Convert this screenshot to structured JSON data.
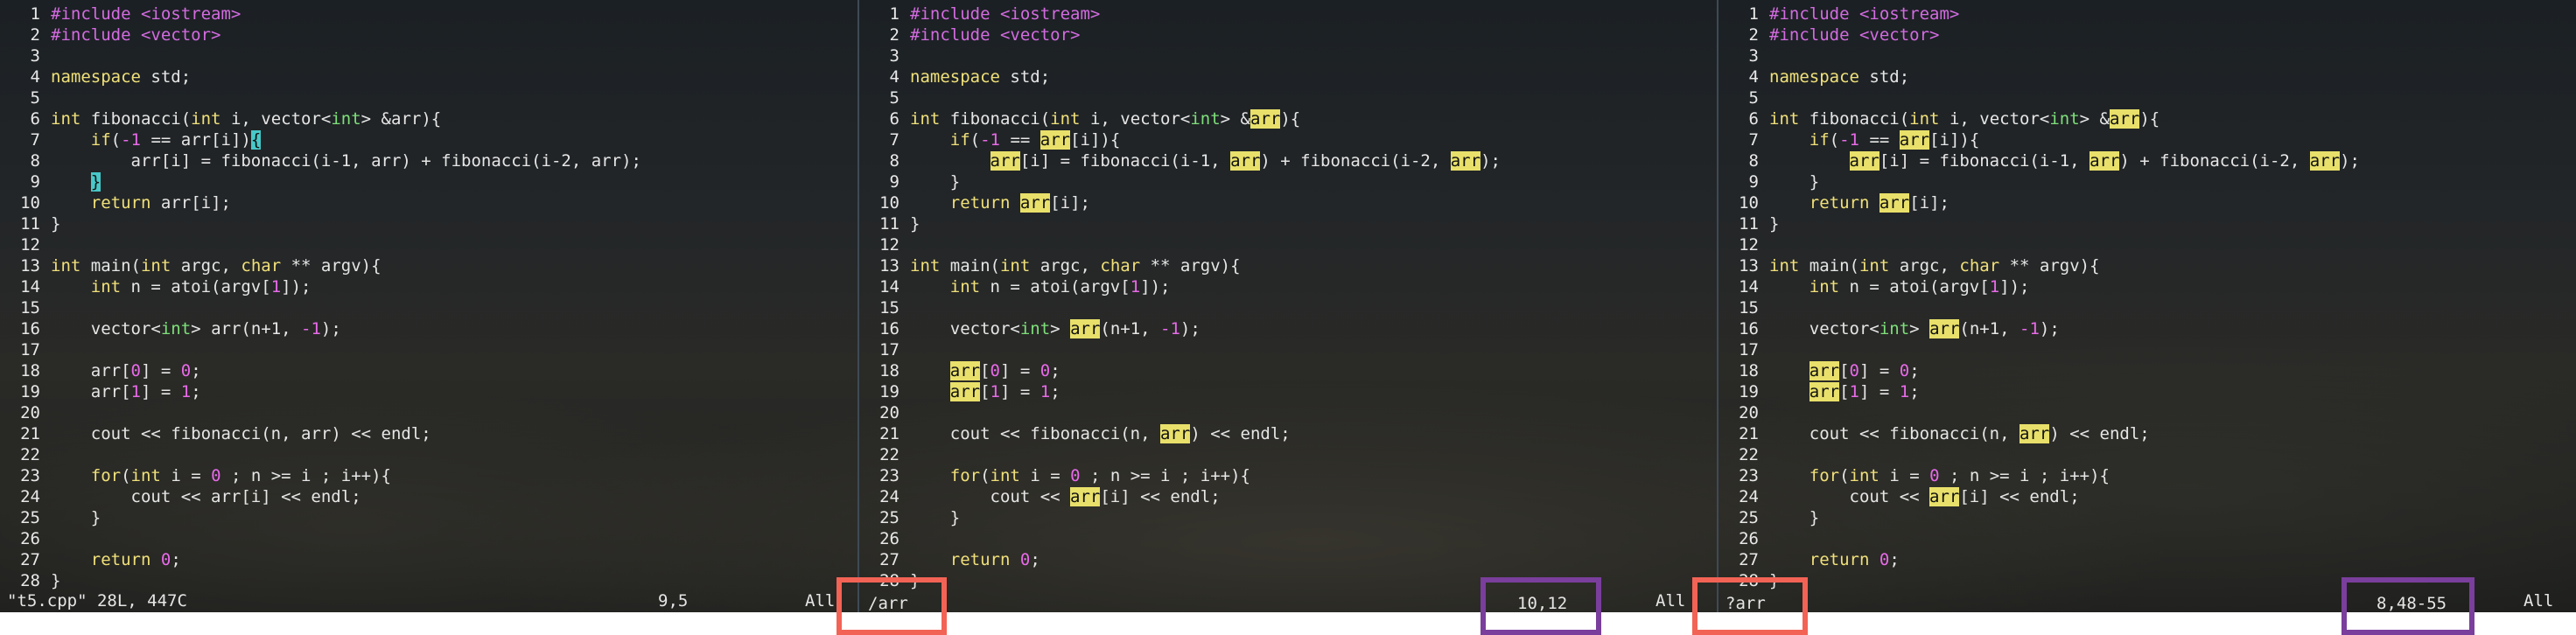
{
  "panes": [
    {
      "line_numbers": [
        "1",
        "2",
        "3",
        "4",
        "5",
        "6",
        "7",
        "8",
        "9",
        "10",
        "11",
        "12",
        "13",
        "14",
        "15",
        "16",
        "17",
        "18",
        "19",
        "20",
        "21",
        "22",
        "23",
        "24",
        "25",
        "26",
        "27",
        "28"
      ],
      "status_left": "\"t5.cpp\" 28L, 447C",
      "status_pos": "9,5",
      "status_all": "All"
    },
    {
      "line_numbers": [
        "1",
        "2",
        "3",
        "4",
        "5",
        "6",
        "7",
        "8",
        "9",
        "10",
        "11",
        "12",
        "13",
        "14",
        "15",
        "16",
        "17",
        "18",
        "19",
        "20",
        "21",
        "22",
        "23",
        "24",
        "25",
        "26",
        "27",
        "28"
      ],
      "command": "/arr",
      "status_pos": "10,12",
      "status_all": "All"
    },
    {
      "line_numbers": [
        "1",
        "2",
        "3",
        "4",
        "5",
        "6",
        "7",
        "8",
        "9",
        "10",
        "11",
        "12",
        "13",
        "14",
        "15",
        "16",
        "17",
        "18",
        "19",
        "20",
        "21",
        "22",
        "23",
        "24",
        "25",
        "26",
        "27",
        "28"
      ],
      "command": "?arr",
      "status_pos": "8,48-55",
      "status_all": "All"
    }
  ],
  "code": {
    "l1_a": "#include ",
    "l1_b": "<iostream>",
    "l2_a": "#include ",
    "l2_b": "<vector>",
    "l4_a": "namespace",
    "l4_b": " std;",
    "l6_a": "int",
    "l6_b": " fibonacci(",
    "l6_c": "int",
    "l6_d": " i, vector<",
    "l6_e": "int",
    "l6_f": "> &",
    "l6_g": "arr",
    "l6_h": "){",
    "l7_a": "    ",
    "l7_b": "if",
    "l7_c": "(",
    "l7_d": "-1",
    "l7_e": " == ",
    "l7_f": "arr",
    "l7_g": "[i]",
    "l7_h": ")",
    "l7_i": "{",
    "l8_a": "        ",
    "l8_b": "arr",
    "l8_c": "[i] = fibonacci(i-1, ",
    "l8_d": "arr",
    "l8_e": ") + fibonacci(i-2, ",
    "l8_f": "arr",
    "l8_g": ");",
    "l9_a": "    ",
    "l9_b": "}",
    "l10_a": "    ",
    "l10_b": "return",
    "l10_c": " ",
    "l10_d": "arr",
    "l10_e": "[i];",
    "l11": "}",
    "l13_a": "int",
    "l13_b": " main(",
    "l13_c": "int",
    "l13_d": " argc, ",
    "l13_e": "char",
    "l13_f": " ** argv){",
    "l14_a": "    ",
    "l14_b": "int",
    "l14_c": " n = atoi(argv[",
    "l14_d": "1",
    "l14_e": "]);",
    "l16_a": "    vector<",
    "l16_b": "int",
    "l16_c": "> ",
    "l16_d": "arr",
    "l16_e": "(n+1, ",
    "l16_f": "-1",
    "l16_g": ");",
    "l18_a": "    ",
    "l18_b": "arr",
    "l18_c": "[",
    "l18_d": "0",
    "l18_e": "] = ",
    "l18_f": "0",
    "l18_g": ";",
    "l19_a": "    ",
    "l19_b": "arr",
    "l19_c": "[",
    "l19_d": "1",
    "l19_e": "] = ",
    "l19_f": "1",
    "l19_g": ";",
    "l21_a": "    cout << fibonacci(n, ",
    "l21_b": "arr",
    "l21_c": ") << endl;",
    "l23_a": "    ",
    "l23_b": "for",
    "l23_c": "(",
    "l23_d": "int",
    "l23_e": " i = ",
    "l23_f": "0",
    "l23_g": " ; n >= i ; i++){",
    "l24_a": "        cout << ",
    "l24_b": "arr",
    "l24_c": "[i] << endl;",
    "l25": "    }",
    "l27_a": "    ",
    "l27_b": "return",
    "l27_c": " ",
    "l27_d": "0",
    "l27_e": ";",
    "l28": "}"
  },
  "colors": {
    "highlight": "#e8e06a",
    "cursor": "#48c8c8",
    "annotation_red": "#f26355",
    "annotation_purple": "#7a3e9c"
  }
}
